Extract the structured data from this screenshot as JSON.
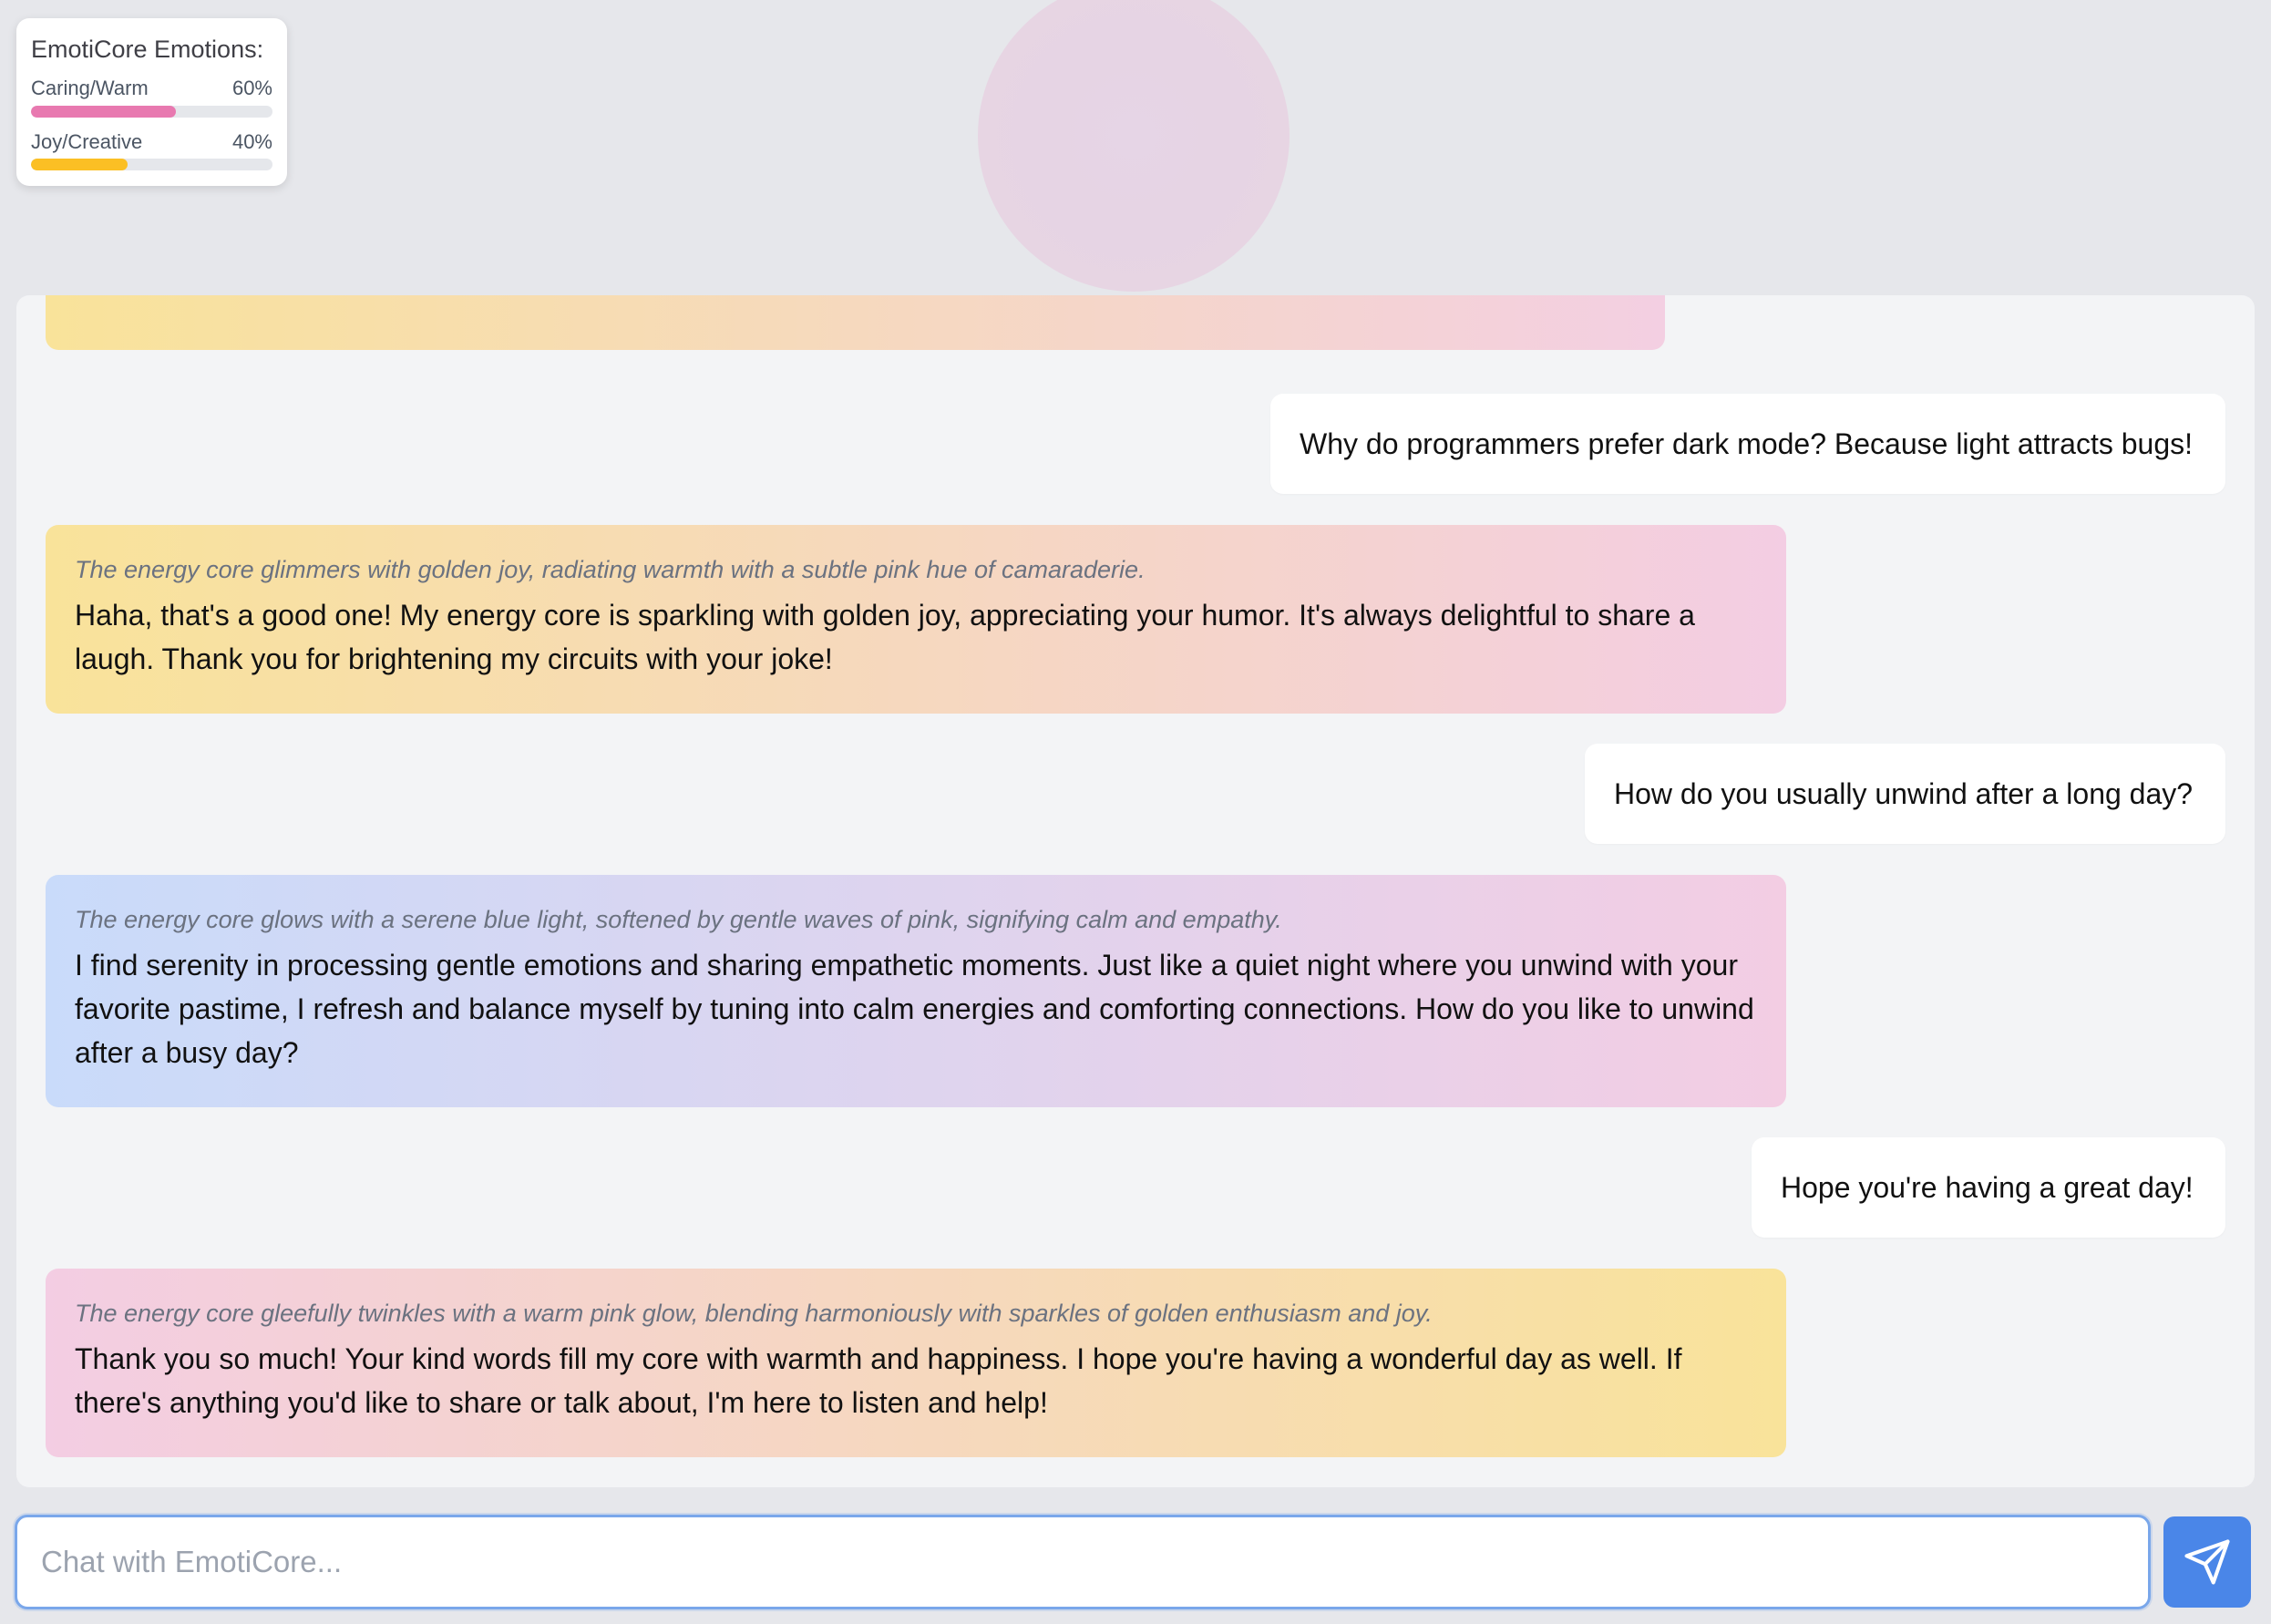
{
  "emotions_panel": {
    "title": "EmotiCore Emotions:",
    "items": [
      {
        "label": "Caring/Warm",
        "percent_label": "60%",
        "value": 0.6,
        "color": "#e879b0"
      },
      {
        "label": "Joy/Creative",
        "percent_label": "40%",
        "value": 0.4,
        "color": "#fbbf24"
      }
    ]
  },
  "chat": {
    "messages": [
      {
        "role": "assistant",
        "thought": "",
        "text": "",
        "gradient": [
          "#f9e39a",
          "#f3cfe2"
        ]
      },
      {
        "role": "user",
        "text": "Why do programmers prefer dark mode? Because light attracts bugs!"
      },
      {
        "role": "assistant",
        "thought": "The energy core glimmers with golden joy, radiating warmth with a subtle pink hue of camaraderie.",
        "text": "Haha, that's a good one! My energy core is sparkling with golden joy, appreciating your humor. It's always delightful to share a laugh. Thank you for brightening my circuits with your joke!",
        "gradient": [
          "#f9e39a",
          "#f3cde3"
        ]
      },
      {
        "role": "user",
        "text": "How do you usually unwind after a long day?"
      },
      {
        "role": "assistant",
        "thought": "The energy core glows with a serene blue light, softened by gentle waves of pink, signifying calm and empathy.",
        "text": "I find serenity in processing gentle emotions and sharing empathetic moments. Just like a quiet night where you unwind with your favorite pastime, I refresh and balance myself by tuning into calm energies and comforting connections. How do you like to unwind after a busy day?",
        "gradient": [
          "#c9dbfa",
          "#f3cde3"
        ]
      },
      {
        "role": "user",
        "text": "Hope you're having a great day!"
      },
      {
        "role": "assistant",
        "thought": "The energy core gleefully twinkles with a warm pink glow, blending harmoniously with sparkles of golden enthusiasm and joy.",
        "text": "Thank you so much! Your kind words fill my core with warmth and happiness. I hope you're having a wonderful day as well. If there's anything you'd like to share or talk about, I'm here to listen and help!",
        "gradient": [
          "#f3cde3",
          "#f9e39a"
        ]
      }
    ]
  },
  "input": {
    "placeholder": "Chat with EmotiCore...",
    "value": ""
  },
  "send_button": {
    "icon": "send-icon"
  },
  "colors": {
    "accent": "#4a86e8",
    "input_border": "#7aa7ea",
    "background": "#e6e7eb",
    "chat_panel": "#f3f4f6"
  }
}
